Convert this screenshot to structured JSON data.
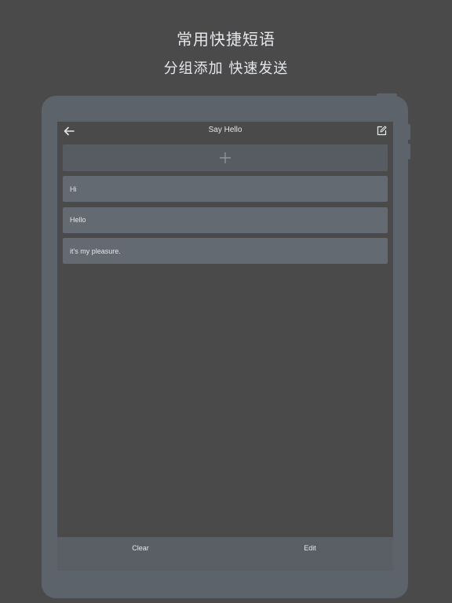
{
  "promo": {
    "title": "常用快捷短语",
    "subtitle": "分组添加 快速发送"
  },
  "nav": {
    "back_icon": "arrow-left-icon",
    "title": "Say Hello",
    "edit_icon": "edit-square-icon"
  },
  "add_row": {
    "icon": "plus-icon"
  },
  "phrases": [
    {
      "text": "Hi"
    },
    {
      "text": "Hello"
    },
    {
      "text": "it's my pleasure."
    }
  ],
  "toolbar": {
    "clear_label": "Clear",
    "edit_label": "Edit"
  },
  "colors": {
    "background": "#4a4a4a",
    "frame": "#5d636b",
    "row": "#646a72",
    "text": "#e4e6ea"
  }
}
